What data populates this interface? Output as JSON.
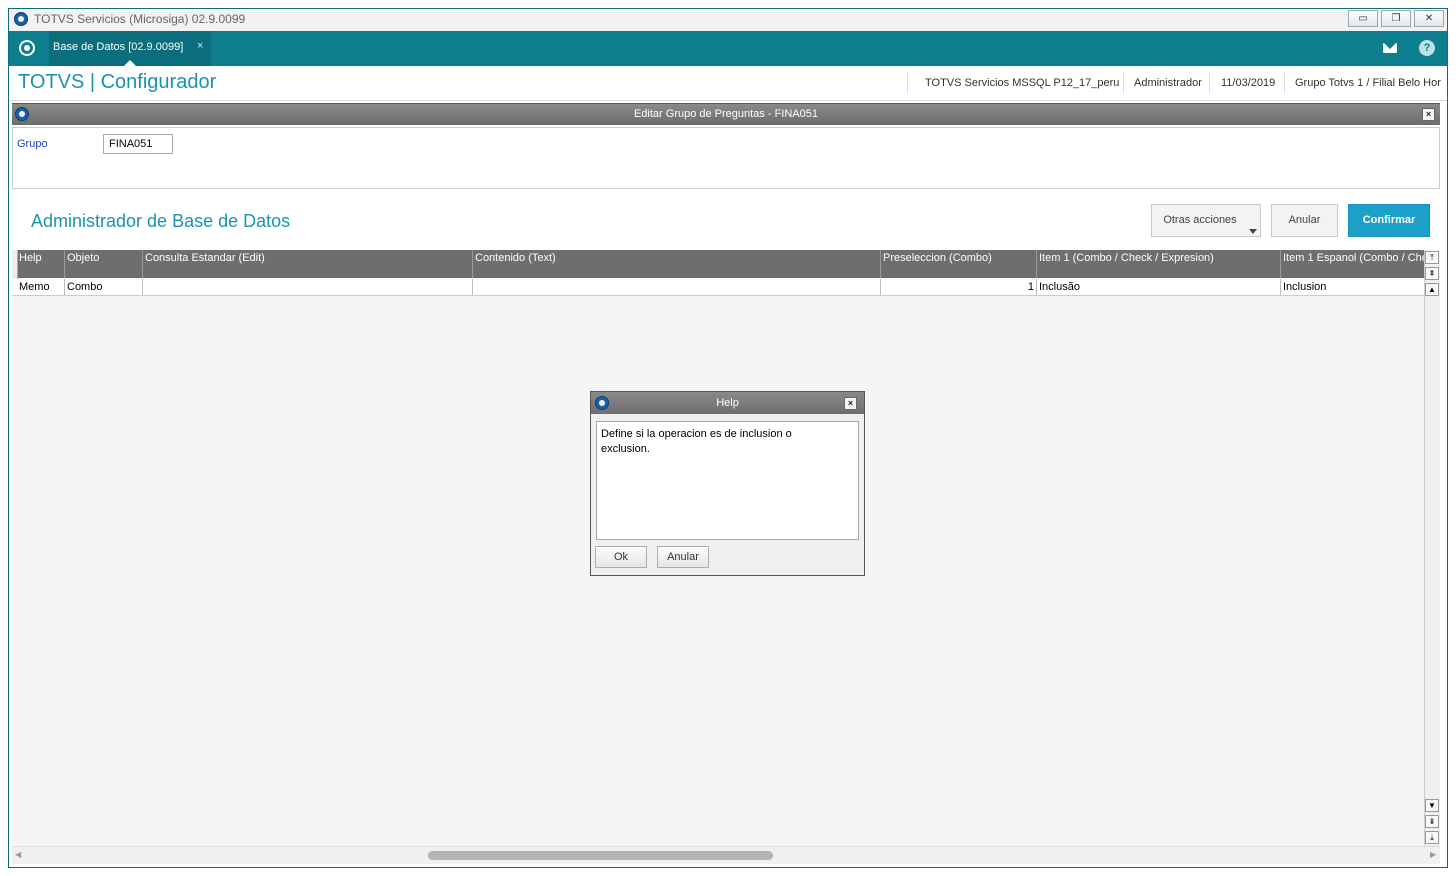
{
  "window": {
    "title": "TOTVS Servicios (Microsiga) 02.9.0099",
    "controls": [
      "minimize",
      "restore",
      "close"
    ]
  },
  "tabbar": {
    "tab_label": "Base de Datos [02.9.0099]",
    "tab_close": "×"
  },
  "header": {
    "app_title": "TOTVS | Configurador",
    "environment": "TOTVS Servicios MSSQL P12_17_peru",
    "user": "Administrador",
    "date": "11/03/2019",
    "company": "Grupo Totvs 1 / Filial Belo Hor"
  },
  "dialog": {
    "title": "Editar Grupo de Preguntas - FINA051",
    "grupo_label": "Grupo",
    "grupo_value": "FINA051"
  },
  "section": {
    "title": "Administrador de Base de Datos",
    "otras_acciones": "Otras acciones",
    "anular": "Anular",
    "confirmar": "Confirmar"
  },
  "grid": {
    "columns": [
      "Help",
      "Objeto",
      "Consulta Estandar (Edit)",
      "Contenido (Text)",
      "Preseleccion (Combo)",
      "Item 1 (Combo / Check / Expresion)",
      "Item 1 Espanol (Combo / Check"
    ],
    "rows": [
      [
        "Memo",
        "Combo",
        "",
        "",
        "1",
        "Inclusão",
        "Inclusion"
      ]
    ]
  },
  "help_popup": {
    "title": "Help",
    "text_line1": "Define si la operacion es de inclusion o",
    "text_line2": "exclusion.",
    "ok": "Ok",
    "anular": "Anular"
  },
  "colors": {
    "accent": "#0d7e8e",
    "title_blue": "#1a94ad",
    "confirm_button": "#1ba1c8",
    "grid_header": "#6e6e6e"
  }
}
